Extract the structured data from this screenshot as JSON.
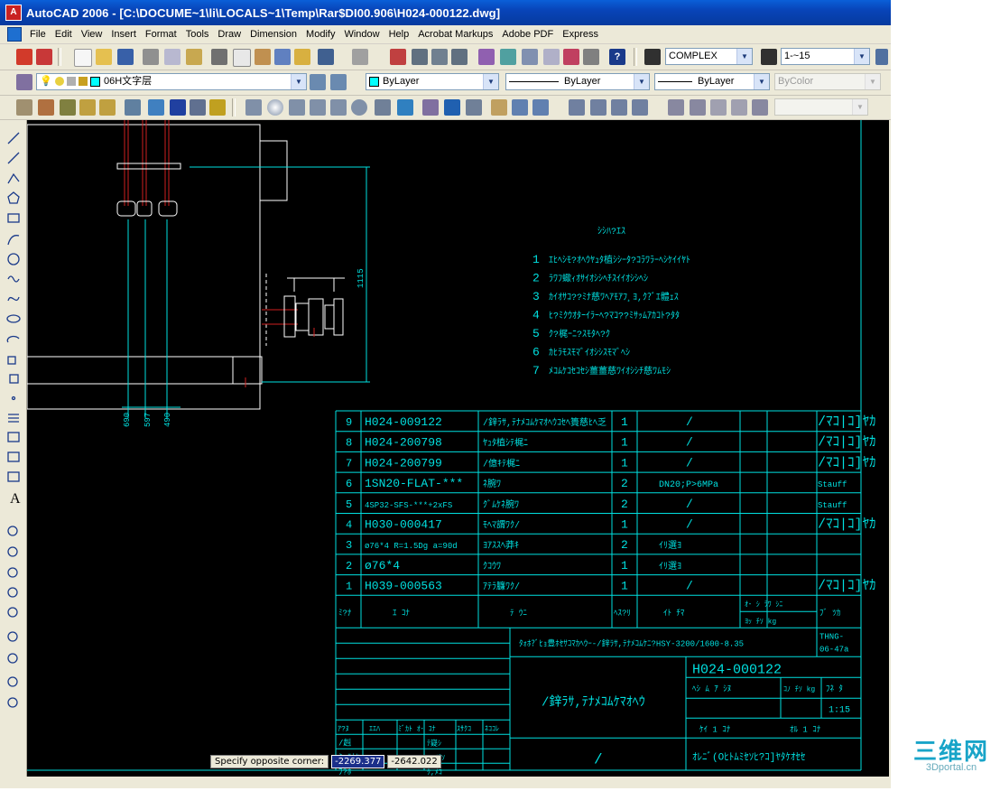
{
  "window": {
    "title": "AutoCAD 2006 - [C:\\DOCUME~1\\li\\LOCALS~1\\Temp\\Rar$DI00.906\\H024-000122.dwg]"
  },
  "menu": [
    "File",
    "Edit",
    "View",
    "Insert",
    "Format",
    "Tools",
    "Draw",
    "Dimension",
    "Modify",
    "Window",
    "Help",
    "Acrobat Markups",
    "Adobe PDF",
    "Express"
  ],
  "toolbar": {
    "text_style": "COMPLEX",
    "dim_scale": "1-~15",
    "layer": "06H文字层",
    "color": "ByLayer",
    "linetype": "ByLayer",
    "lineweight": "ByLayer",
    "plot_style": "ByColor"
  },
  "drawing": {
    "dims": {
      "left1": "690",
      "left2": "597",
      "left3": "490",
      "vertical": "1115"
    },
    "notes_title": "ｼｼﾊ?ｴｽ",
    "notes": [
      {
        "n": "1",
        "text": "ｴﾋﾍｼﾓ?ｵﾍｳﾔｭﾀ植ｼｼｰﾀ?ｺﾗﾜﾗｰﾍｼｹｲｲﾔﾄ"
      },
      {
        "n": "2",
        "text": "ﾗﾜﾌ蠍ｨｵｻｲｵｼｼﾍﾁｽｲｲｵｼｼﾍｼ"
      },
      {
        "n": "3",
        "text": "ｶｲｵｻｺ??ﾐﾅ慈ﾜﾍｱﾓｱﾌ¸ﾖ,ｸ?ﾞｴ體ｪｽ"
      },
      {
        "n": "4",
        "text": "ﾋ?ﾐｸｳｵﾀｰｲﾗｰﾍ?ﾏｺ??ﾐｻｯﾑｱｶｺﾄ?ﾀﾀ"
      },
      {
        "n": "5",
        "text": "ｸ?梶ｰﾆ?ｽﾓﾀﾍ?ｸ"
      },
      {
        "n": "6",
        "text": "ｶﾋﾗﾓｽﾓﾏﾞｲｵｼｼｽﾓﾏﾞﾍｼ"
      },
      {
        "n": "7",
        "text": "ﾒｺﾑｹｺｾｺｾｼ薑薑慈ﾜｲｵｼｼﾁ慈ﾜﾑﾓｼ"
      }
    ],
    "bom_rows": [
      {
        "no": "9",
        "code": "H024-009122",
        "name": "/鋅ﾗｻ,ﾃﾅﾒｺﾑｹﾏｵﾍｳｺｾﾍ簣慈ﾋﾍ乏",
        "qty": "1",
        "spec": "/",
        "note": "/ﾏｺ|ｺ]ﾔｶ"
      },
      {
        "no": "8",
        "code": "H024-200798",
        "name": "ﾔｭﾀ植ｼﾃ梶ﾆ",
        "qty": "1",
        "spec": "/",
        "note": "/ﾏｺ|ｺ]ﾔｶ"
      },
      {
        "no": "7",
        "code": "H024-200799",
        "name": "/億ｷﾃ梶ﾆ",
        "qty": "1",
        "spec": "/",
        "note": "/ﾏｺ|ｺ]ﾔｶ"
      },
      {
        "no": "6",
        "code": "1SN20-FLAT-***",
        "name": "ﾈ腕ﾜ",
        "qty": "2",
        "spec": "DN20;P>6MPa",
        "note": "Stauff"
      },
      {
        "no": "5",
        "code": "4SP32-SFS-***+2xFS",
        "name": "ｸﾞﾑｹﾈ腕ﾜ",
        "qty": "2",
        "spec": "/",
        "note": "Stauff"
      },
      {
        "no": "4",
        "code": "H030-000417",
        "name": "ﾓﾍﾏ謂ﾜｸ/",
        "qty": "1",
        "spec": "/",
        "note": "/ﾏｺ|ｺ]ﾔｶ"
      },
      {
        "no": "3",
        "code": "ø76*4 R=1.5Dg a=90d",
        "name": "ﾖｱｽｽﾍ莽ｷ",
        "qty": "2",
        "spec": "ｲﾘ選ﾖ",
        "note": ""
      },
      {
        "no": "2",
        "code": "ø76*4",
        "name": "ｸｺｳﾜ",
        "qty": "1",
        "spec": "ｲﾘ選ﾖ",
        "note": ""
      },
      {
        "no": "1",
        "code": "H039-000563",
        "name": "ｱﾃﾗ臁ﾜｸ/",
        "qty": "1",
        "spec": "/",
        "note": "/ﾏｺ|ｺ]ﾔｶ"
      }
    ],
    "bom_header": {
      "no": "ﾐ?ﾅ",
      "code": "ｴ   ｺﾅ",
      "name": "ﾃ       ｳﾆ",
      "qty": "ﾍｽ?ﾘ",
      "material": "ｲﾄ     ﾁﾏ",
      "weight": "ｵ･ ｼ    ﾗﾜ ｼﾆ",
      "weight_sub": "ﾖｯ    ﾁｿ  kg",
      "remark": "ﾌﾞ ﾂｶ"
    },
    "title_block": {
      "project_line": "ﾀｫﾎ?ﾞﾋｮ豊ﾎｾｻｺﾏｶﾍｳｰ-/鋅ﾗｻ,ﾃﾅﾒｺﾑｹﾆ?HSY-3200/1600-8.35",
      "std_code": "THNG-06-47a",
      "drawing_name": "/鋅ﾗｻ,ﾃﾅﾒｺﾑｹﾏｵﾍｳ",
      "drawing_no": "H024-000122",
      "scale": "1:15",
      "sheet_row": "ｹｲ   1   ｺﾅ",
      "sheet_row2": "ｵﾙ   1   ｺﾅ",
      "company": "ｵﾚﾆﾞ(Oﾋﾄﾑﾐｾｿﾋ?ｺ]ﾔﾀｹｵｾｾ",
      "stage_labels": "ﾍｼ  ﾑ    ｱ    ｼﾇ",
      "weight_label": "ｺﾉ ﾁｿ kg",
      "ratio_label": "ﾌﾈ   ﾀ",
      "sign_headers": [
        "ｱ?ﾇ",
        "ｴｴﾊ",
        "ﾐﾞｶﾄ ｵ･ ｺﾅ",
        "ｽｻｸｺ",
        "ﾈｺｺﾚ"
      ],
      "sign_rows": [
        "/赳",
        "ﾐ ﾃｶﾔ",
        "ﾌ?ﾎ",
        "ｸ?ｲ?"
      ],
      "sign_cols": [
        "ﾃ嶷ｼ",
        "ﾖﾍｲﾁｿ",
        "ｸ,ﾒｺ",
        "ｽﾓｿﾙ",
        "ｴｴﾎｴ"
      ],
      "bottom_cell": "/"
    }
  },
  "command": {
    "prompt": "Specify opposite corner:",
    "x": "-2269.377",
    "y": "-2642.022"
  },
  "watermark": {
    "main": "三维网",
    "sub": "3Dportal.cn"
  }
}
